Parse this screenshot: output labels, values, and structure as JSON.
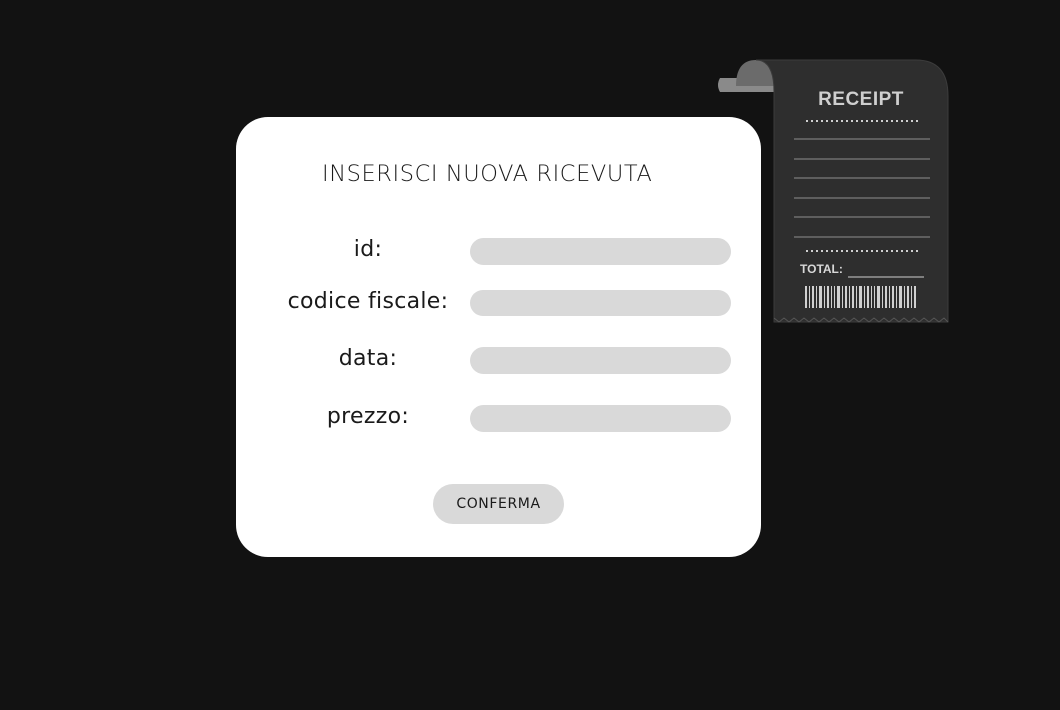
{
  "form": {
    "title": "INSERISCI NUOVA RICEVUTA",
    "fields": [
      {
        "label": "id:",
        "value": "",
        "placeholder": ""
      },
      {
        "label": "codice fiscale:",
        "value": "",
        "placeholder": ""
      },
      {
        "label": "data:",
        "value": "",
        "placeholder": ""
      },
      {
        "label": "prezzo:",
        "value": "",
        "placeholder": ""
      }
    ],
    "confirm_label": "CONFERMA"
  },
  "receipt_illustration": {
    "title": "RECEIPT",
    "total_label": "TOTAL:"
  },
  "colors": {
    "background": "#121212",
    "card": "#ffffff",
    "input": "#d9d9d9",
    "receipt": "#2e2e2e",
    "receipt_text": "#cfcfcf"
  }
}
